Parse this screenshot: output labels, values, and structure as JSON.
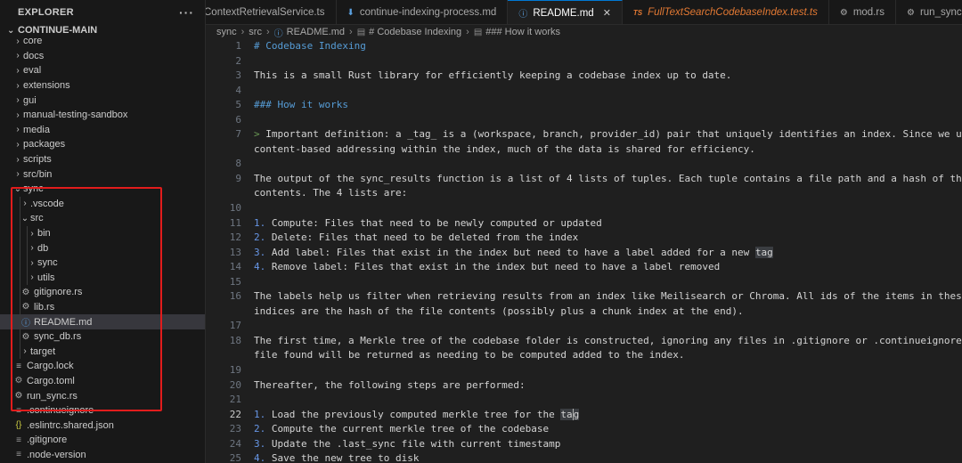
{
  "explorer": {
    "title": "EXPLORER",
    "more": "···",
    "root": "CONTINUE-MAIN",
    "items": [
      {
        "label": "core",
        "kind": "folder-collapsed"
      },
      {
        "label": "docs",
        "kind": "folder-collapsed"
      },
      {
        "label": "eval",
        "kind": "folder-collapsed"
      },
      {
        "label": "extensions",
        "kind": "folder-collapsed"
      },
      {
        "label": "gui",
        "kind": "folder-collapsed"
      },
      {
        "label": "manual-testing-sandbox",
        "kind": "folder-collapsed"
      },
      {
        "label": "media",
        "kind": "folder-collapsed"
      },
      {
        "label": "packages",
        "kind": "folder-collapsed"
      },
      {
        "label": "scripts",
        "kind": "folder-collapsed"
      },
      {
        "label": "src/bin",
        "kind": "folder-collapsed"
      },
      {
        "label": "sync",
        "kind": "folder-expanded"
      },
      {
        "label": ".vscode",
        "kind": "folder-collapsed"
      },
      {
        "label": "src",
        "kind": "folder-expanded"
      },
      {
        "label": "bin",
        "kind": "folder-collapsed"
      },
      {
        "label": "db",
        "kind": "folder-collapsed"
      },
      {
        "label": "sync",
        "kind": "folder-collapsed"
      },
      {
        "label": "utils",
        "kind": "folder-collapsed"
      },
      {
        "label": "gitignore.rs",
        "kind": "rust-file"
      },
      {
        "label": "lib.rs",
        "kind": "rust-file"
      },
      {
        "label": "README.md",
        "kind": "markdown-file"
      },
      {
        "label": "sync_db.rs",
        "kind": "rust-file"
      },
      {
        "label": "target",
        "kind": "folder-collapsed"
      },
      {
        "label": "Cargo.lock",
        "kind": "lock-file"
      },
      {
        "label": "Cargo.toml",
        "kind": "gear-file"
      },
      {
        "label": "run_sync.rs",
        "kind": "rust-file"
      },
      {
        "label": ".continueignore",
        "kind": "lines-file"
      },
      {
        "label": ".eslintrc.shared.json",
        "kind": "json-file"
      },
      {
        "label": ".gitignore",
        "kind": "lines-file"
      },
      {
        "label": ".node-version",
        "kind": "lines-file"
      }
    ]
  },
  "tabs": [
    {
      "label": "ContextRetrievalService.ts",
      "icon": "ts-icon"
    },
    {
      "label": "continue-indexing-process.md",
      "icon": "markdown-icon"
    },
    {
      "label": "README.md",
      "icon": "info-icon",
      "close": "✕"
    },
    {
      "label": "FullTextSearchCodebaseIndex.test.ts",
      "icon": "ts-icon"
    },
    {
      "label": "mod.rs",
      "icon": "rust-icon"
    },
    {
      "label": "run_sync.rs",
      "icon": "rust-icon"
    }
  ],
  "breadcrumb": [
    "sync",
    "src",
    "README.md",
    "# Codebase Indexing",
    "### How it works"
  ],
  "editor": {
    "line_numbers": [
      "1",
      "2",
      "3",
      "4",
      "5",
      "6",
      "7",
      "8",
      "9",
      "10",
      "11",
      "12",
      "13",
      "14",
      "15",
      "16",
      "17",
      "18",
      "19",
      "20",
      "21",
      "22",
      "23",
      "24",
      "25"
    ],
    "current_line": "22",
    "lines": [
      "# Codebase Indexing",
      "",
      "This is a small Rust library for efficiently keeping a codebase index up to date.",
      "",
      "### How it works",
      "",
      "> Important definition: a _tag_ is a (workspace, branch, provider_id) pair that uniquely identifies an index. Since we use",
      "content-based addressing within the index, much of the data is shared for efficiency.",
      "",
      "The output of the sync_results function is a list of 4 lists of tuples. Each tuple contains a file path and a hash of the file",
      "contents. The 4 lists are:",
      "",
      "1. Compute: Files that need to be newly computed or updated",
      "2. Delete: Files that need to be deleted from the index",
      "3. Add label: Files that exist in the index but need to have a label added for a new tag",
      "4. Remove label: Files that exist in the index but need to have a label removed",
      "",
      "The labels help us filter when retrieving results from an index like Meilisearch or Chroma. All ids of the items in these",
      "indices are the hash of the file contents (possibly plus a chunk index at the end).",
      "",
      "The first time, a Merkle tree of the codebase folder is constructed, ignoring any files in .gitignore or .continueignore. Every",
      "file found will be returned as needing to be computed added to the index.",
      "",
      "Thereafter, the following steps are performed:",
      "",
      "1. Load the previously computed merkle tree for the tag",
      "2. Compute the current merkle tree of the codebase",
      "3. Update the .last_sync file with current timestamp",
      "4. Save the new tree to disk"
    ]
  }
}
